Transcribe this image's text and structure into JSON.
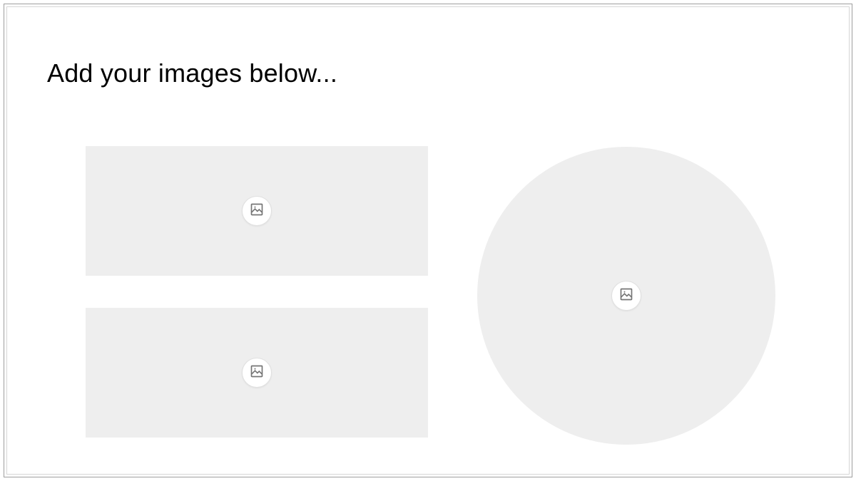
{
  "title": "Add your images below...",
  "placeholders": {
    "rect1": {
      "icon": "image-icon"
    },
    "rect2": {
      "icon": "image-icon"
    },
    "circle": {
      "icon": "image-icon"
    }
  },
  "colors": {
    "placeholderFill": "#eeeeee",
    "iconStroke": "#757575",
    "border": "#9e9e9e"
  }
}
